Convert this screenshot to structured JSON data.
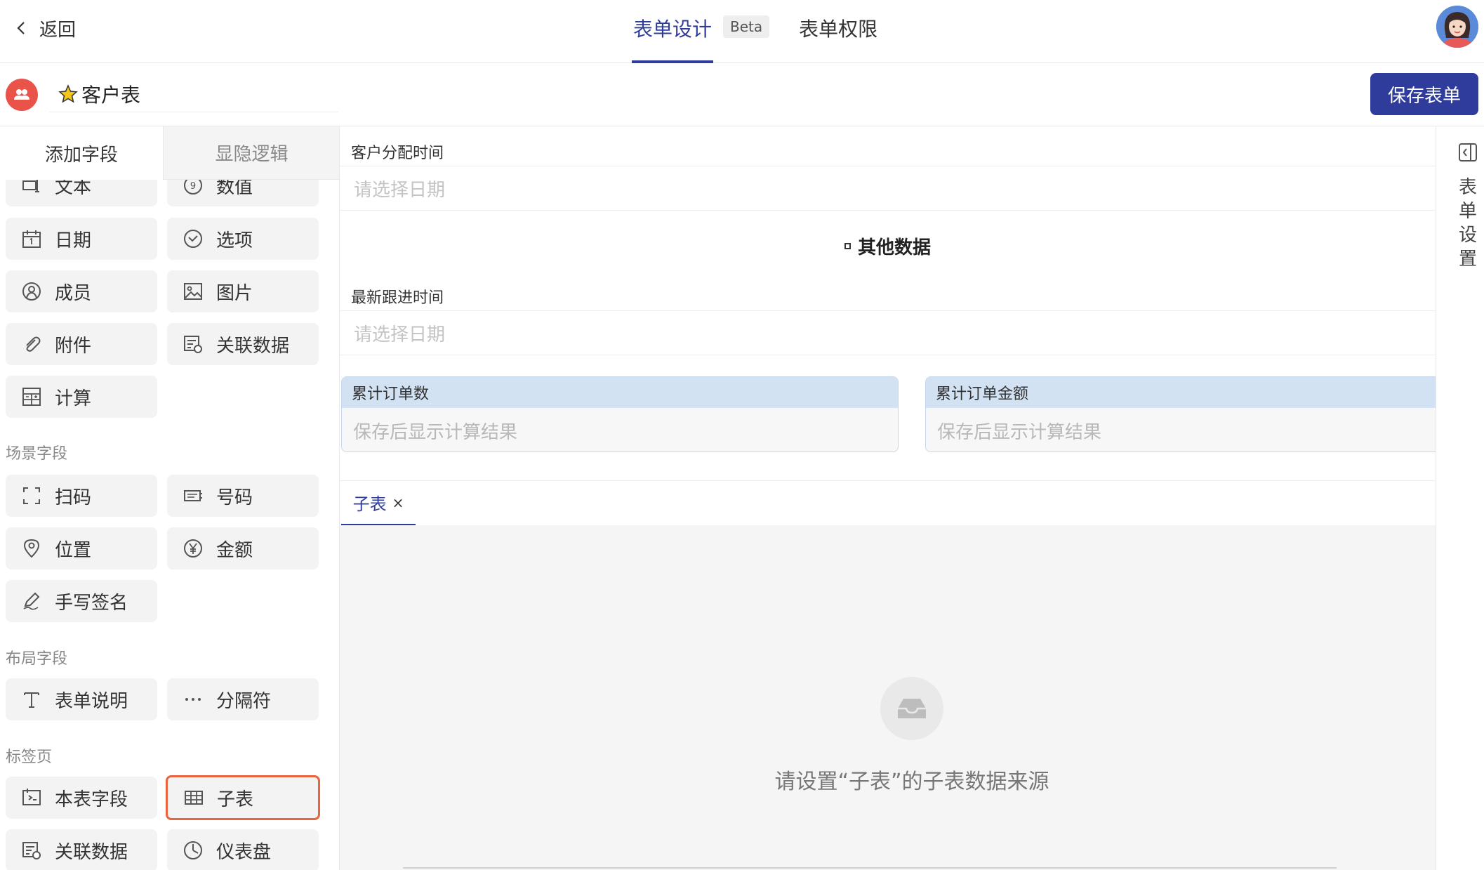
{
  "topbar": {
    "back_label": "返回",
    "tab_design": "表单设计",
    "beta_badge": "Beta",
    "tab_permissions": "表单权限"
  },
  "form_header": {
    "form_name": "客户表",
    "save_button": "保存表单"
  },
  "left_panel": {
    "tab_add_field": "添加字段",
    "tab_visibility_logic": "显隐逻辑",
    "basic_fields": [
      {
        "label": "文本",
        "icon": "text-field-icon"
      },
      {
        "label": "数值",
        "icon": "number-icon"
      },
      {
        "label": "日期",
        "icon": "calendar-icon"
      },
      {
        "label": "选项",
        "icon": "option-check-icon"
      },
      {
        "label": "成员",
        "icon": "member-icon"
      },
      {
        "label": "图片",
        "icon": "image-icon"
      },
      {
        "label": "附件",
        "icon": "paperclip-icon"
      },
      {
        "label": "关联数据",
        "icon": "linked-data-icon"
      },
      {
        "label": "计算",
        "icon": "calculator-icon"
      }
    ],
    "section_scene": "场景字段",
    "scene_fields": [
      {
        "label": "扫码",
        "icon": "scan-icon"
      },
      {
        "label": "号码",
        "icon": "serial-number-icon"
      },
      {
        "label": "位置",
        "icon": "location-pin-icon"
      },
      {
        "label": "金额",
        "icon": "yen-icon"
      },
      {
        "label": "手写签名",
        "icon": "signature-pen-icon"
      }
    ],
    "section_layout": "布局字段",
    "layout_fields": [
      {
        "label": "表单说明",
        "icon": "text-t-icon"
      },
      {
        "label": "分隔符",
        "icon": "ellipsis-icon"
      }
    ],
    "section_tabs": "标签页",
    "tab_fields": [
      {
        "label": "本表字段",
        "icon": "this-form-field-icon"
      },
      {
        "label": "子表",
        "icon": "table-grid-icon"
      },
      {
        "label": "关联数据",
        "icon": "linked-data-icon"
      },
      {
        "label": "仪表盘",
        "icon": "dashboard-gauge-icon"
      }
    ]
  },
  "canvas": {
    "field_assign_time_label": "客户分配时间",
    "field_assign_time_placeholder": "请选择日期",
    "divider_other_data": "其他数据",
    "field_latest_follow_label": "最新跟进时间",
    "field_latest_follow_placeholder": "请选择日期",
    "calc_order_count_label": "累计订单数",
    "calc_order_count_placeholder": "保存后显示计算结果",
    "calc_order_amount_label": "累计订单金额",
    "calc_order_amount_placeholder": "保存后显示计算结果",
    "subtab_label": "子表",
    "subtab_close": "×",
    "empty_message": "请设置“子表”的子表数据来源"
  },
  "right_rail": {
    "settings_label": "表单设置"
  },
  "colors": {
    "primary": "#2f3c9b",
    "form_icon_bg": "#e9534a",
    "highlight_border": "#e8643c",
    "calc_header_bg": "#d2e2f3"
  }
}
